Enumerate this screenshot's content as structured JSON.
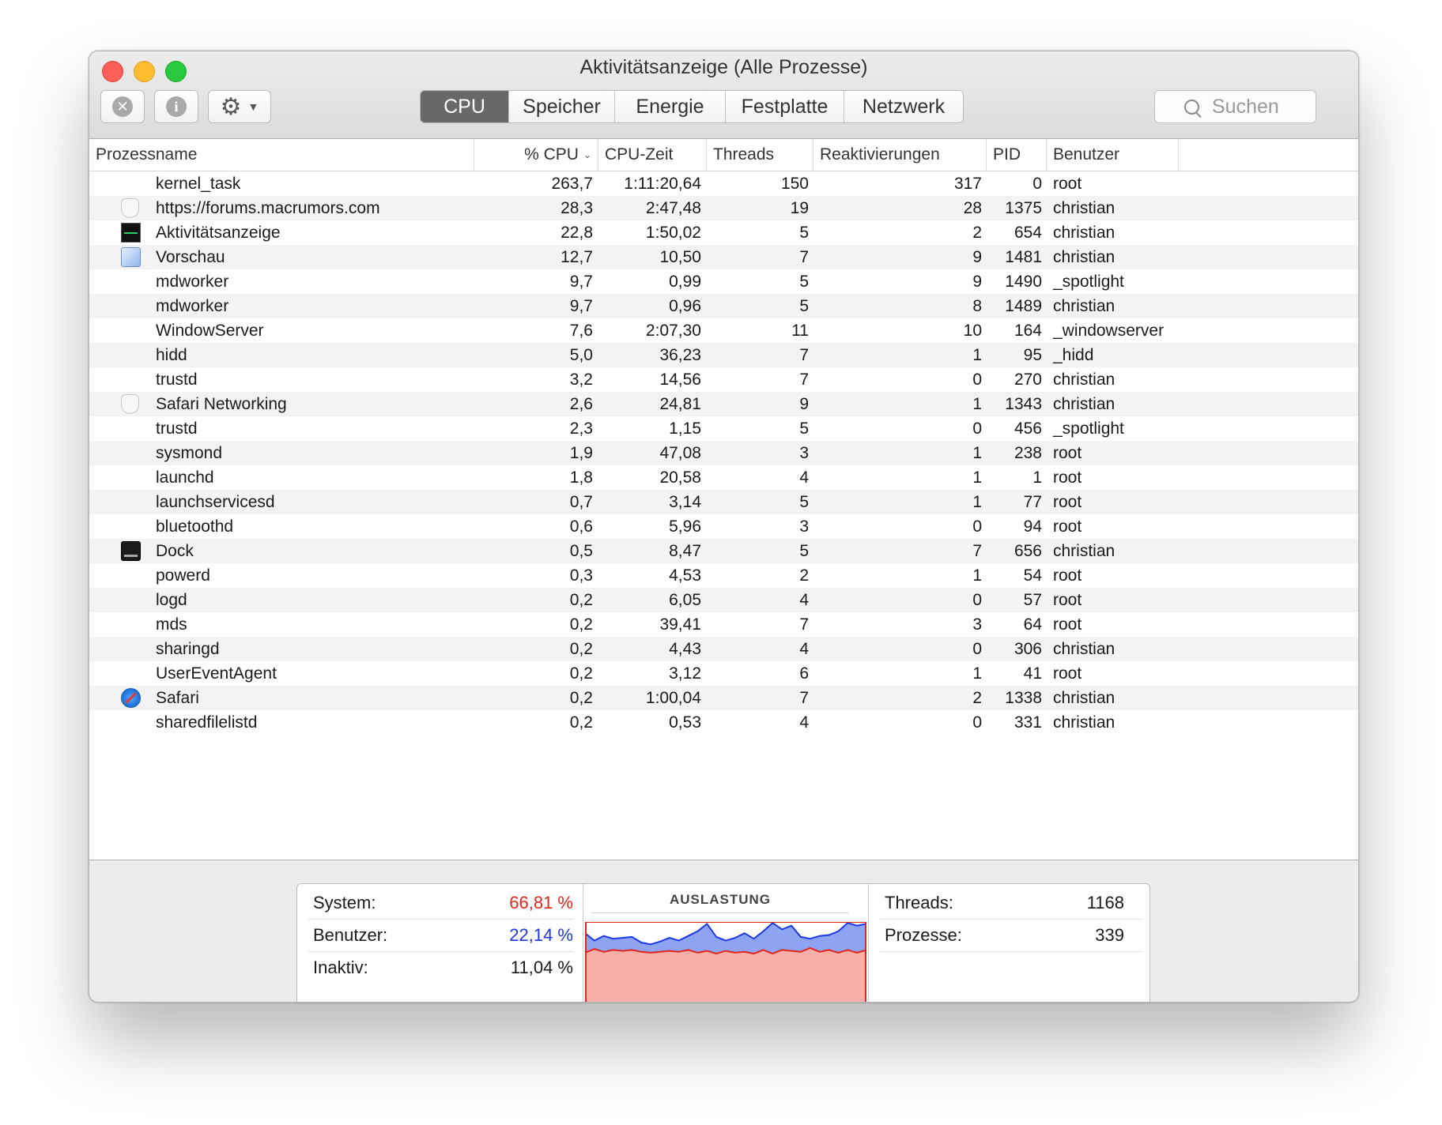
{
  "window": {
    "title": "Aktivitätsanzeige (Alle Prozesse)"
  },
  "toolbar": {
    "stop_icon": "x-circle-icon",
    "info_icon": "info-icon",
    "action_icon": "gear-icon",
    "tabs": [
      "CPU",
      "Speicher",
      "Energie",
      "Festplatte",
      "Netzwerk"
    ],
    "active_tab": "CPU",
    "search_placeholder": "Suchen"
  },
  "table": {
    "columns": [
      "Prozessname",
      "% CPU",
      "CPU-Zeit",
      "Threads",
      "Reaktivierungen",
      "PID",
      "Benutzer"
    ],
    "sort_column": "% CPU",
    "rows": [
      {
        "name": "kernel_task",
        "icon": "",
        "cpu": "263,7",
        "time": "1:11:20,64",
        "threads": "150",
        "wakeups": "317",
        "pid": "0",
        "user": "root"
      },
      {
        "name": "https://forums.macrumors.com",
        "icon": "shield-icon",
        "cpu": "28,3",
        "time": "2:47,48",
        "threads": "19",
        "wakeups": "28",
        "pid": "1375",
        "user": "christian"
      },
      {
        "name": "Aktivitätsanzeige",
        "icon": "activity-monitor-icon",
        "cpu": "22,8",
        "time": "1:50,02",
        "threads": "5",
        "wakeups": "2",
        "pid": "654",
        "user": "christian"
      },
      {
        "name": "Vorschau",
        "icon": "preview-icon",
        "cpu": "12,7",
        "time": "10,50",
        "threads": "7",
        "wakeups": "9",
        "pid": "1481",
        "user": "christian"
      },
      {
        "name": "mdworker",
        "icon": "",
        "cpu": "9,7",
        "time": "0,99",
        "threads": "5",
        "wakeups": "9",
        "pid": "1490",
        "user": "_spotlight"
      },
      {
        "name": "mdworker",
        "icon": "",
        "cpu": "9,7",
        "time": "0,96",
        "threads": "5",
        "wakeups": "8",
        "pid": "1489",
        "user": "christian"
      },
      {
        "name": "WindowServer",
        "icon": "",
        "cpu": "7,6",
        "time": "2:07,30",
        "threads": "11",
        "wakeups": "10",
        "pid": "164",
        "user": "_windowserver"
      },
      {
        "name": "hidd",
        "icon": "",
        "cpu": "5,0",
        "time": "36,23",
        "threads": "7",
        "wakeups": "1",
        "pid": "95",
        "user": "_hidd"
      },
      {
        "name": "trustd",
        "icon": "",
        "cpu": "3,2",
        "time": "14,56",
        "threads": "7",
        "wakeups": "0",
        "pid": "270",
        "user": "christian"
      },
      {
        "name": "Safari Networking",
        "icon": "shield-icon",
        "cpu": "2,6",
        "time": "24,81",
        "threads": "9",
        "wakeups": "1",
        "pid": "1343",
        "user": "christian"
      },
      {
        "name": "trustd",
        "icon": "",
        "cpu": "2,3",
        "time": "1,15",
        "threads": "5",
        "wakeups": "0",
        "pid": "456",
        "user": "_spotlight"
      },
      {
        "name": "sysmond",
        "icon": "",
        "cpu": "1,9",
        "time": "47,08",
        "threads": "3",
        "wakeups": "1",
        "pid": "238",
        "user": "root"
      },
      {
        "name": "launchd",
        "icon": "",
        "cpu": "1,8",
        "time": "20,58",
        "threads": "4",
        "wakeups": "1",
        "pid": "1",
        "user": "root"
      },
      {
        "name": "launchservicesd",
        "icon": "",
        "cpu": "0,7",
        "time": "3,14",
        "threads": "5",
        "wakeups": "1",
        "pid": "77",
        "user": "root"
      },
      {
        "name": "bluetoothd",
        "icon": "",
        "cpu": "0,6",
        "time": "5,96",
        "threads": "3",
        "wakeups": "0",
        "pid": "94",
        "user": "root"
      },
      {
        "name": "Dock",
        "icon": "dock-icon",
        "cpu": "0,5",
        "time": "8,47",
        "threads": "5",
        "wakeups": "7",
        "pid": "656",
        "user": "christian"
      },
      {
        "name": "powerd",
        "icon": "",
        "cpu": "0,3",
        "time": "4,53",
        "threads": "2",
        "wakeups": "1",
        "pid": "54",
        "user": "root"
      },
      {
        "name": "logd",
        "icon": "",
        "cpu": "0,2",
        "time": "6,05",
        "threads": "4",
        "wakeups": "0",
        "pid": "57",
        "user": "root"
      },
      {
        "name": "mds",
        "icon": "",
        "cpu": "0,2",
        "time": "39,41",
        "threads": "7",
        "wakeups": "3",
        "pid": "64",
        "user": "root"
      },
      {
        "name": "sharingd",
        "icon": "",
        "cpu": "0,2",
        "time": "4,43",
        "threads": "4",
        "wakeups": "0",
        "pid": "306",
        "user": "christian"
      },
      {
        "name": "UserEventAgent",
        "icon": "",
        "cpu": "0,2",
        "time": "3,12",
        "threads": "6",
        "wakeups": "1",
        "pid": "41",
        "user": "root"
      },
      {
        "name": "Safari",
        "icon": "safari-icon",
        "cpu": "0,2",
        "time": "1:00,04",
        "threads": "7",
        "wakeups": "2",
        "pid": "1338",
        "user": "christian"
      },
      {
        "name": "sharedfilelistd",
        "icon": "",
        "cpu": "0,2",
        "time": "0,53",
        "threads": "4",
        "wakeups": "0",
        "pid": "331",
        "user": "christian"
      }
    ]
  },
  "summary": {
    "system_label": "System:",
    "system_value": "66,81 %",
    "user_label": "Benutzer:",
    "user_value": "22,14 %",
    "idle_label": "Inaktiv:",
    "idle_value": "11,04 %",
    "graph_title": "AUSLASTUNG",
    "threads_label": "Threads:",
    "threads_value": "1168",
    "processes_label": "Prozesse:",
    "processes_value": "339",
    "colors": {
      "system": "#e3261a",
      "user": "#1b39e6",
      "system_fill": "#f6b0a8",
      "user_fill": "#8fa3f3"
    }
  },
  "chart_data": {
    "type": "area",
    "series": [
      {
        "name": "System",
        "values": [
          67,
          71,
          68,
          70,
          69,
          70,
          68,
          67,
          68,
          69,
          68,
          70,
          67,
          69,
          66,
          69,
          67,
          68,
          66,
          70,
          66,
          70,
          69,
          68,
          72,
          68,
          70,
          67,
          70,
          67,
          70
        ]
      },
      {
        "name": "Benutzer",
        "values": [
          88,
          80,
          85,
          82,
          83,
          84,
          78,
          76,
          79,
          83,
          80,
          85,
          90,
          98,
          84,
          80,
          83,
          88,
          82,
          90,
          99,
          92,
          96,
          84,
          82,
          85,
          86,
          90,
          99,
          96,
          98
        ]
      }
    ],
    "ylim": [
      0,
      100
    ]
  }
}
